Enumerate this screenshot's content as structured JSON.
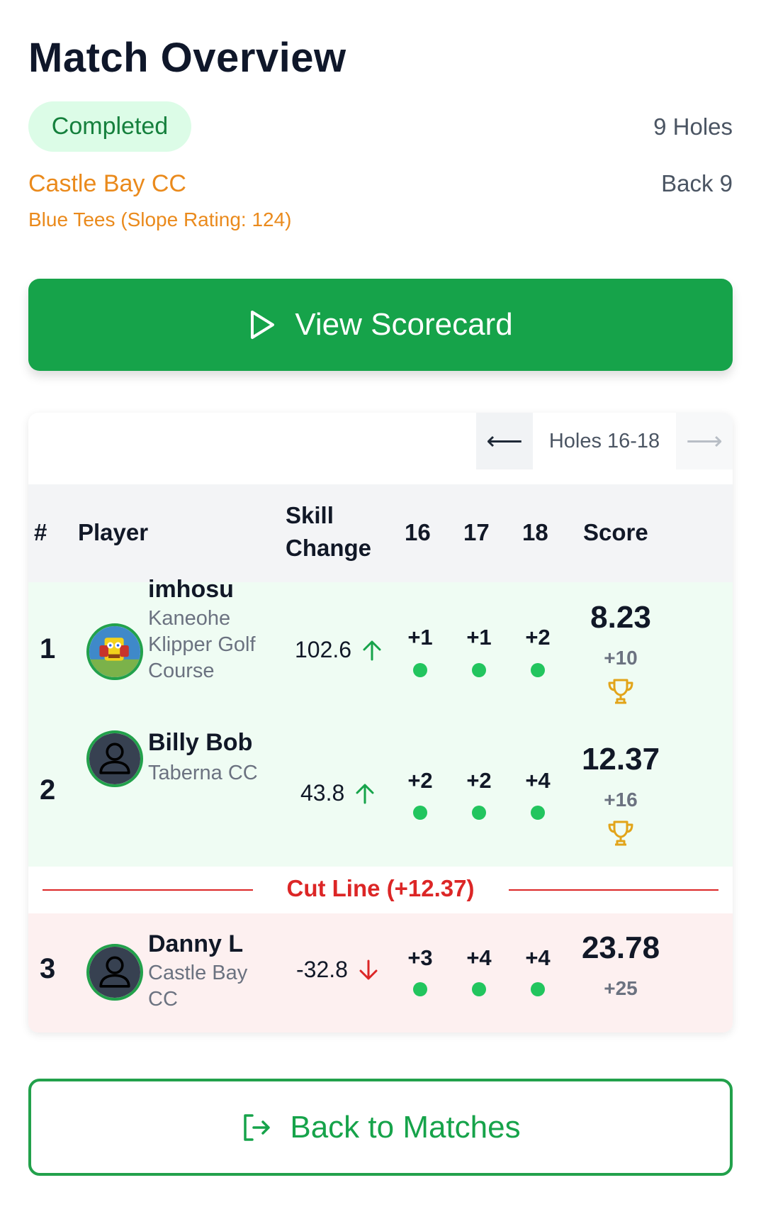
{
  "header": {
    "title": "Match Overview",
    "status": "Completed",
    "holes": "9 Holes",
    "course": "Castle Bay CC",
    "nine": "Back 9",
    "tees": "Blue Tees (Slope Rating: 124)"
  },
  "actions": {
    "view_scorecard": "View Scorecard",
    "back_to_matches": "Back to Matches"
  },
  "leaderboard": {
    "nav": {
      "prev_icon": "arrow-left-icon",
      "range": "Holes 16-18",
      "next_icon": "arrow-right-icon"
    },
    "columns": {
      "rank": "#",
      "player": "Player",
      "skill_line1": "Skill",
      "skill_line2": "Change",
      "h1": "16",
      "h2": "17",
      "h3": "18",
      "score": "Score"
    },
    "rows": [
      {
        "rank": "1",
        "name": "imhosu",
        "club_lines": [
          "Kaneohe",
          "Klipper Golf",
          "Course"
        ],
        "skill": "102.6",
        "skill_trend": "up",
        "holes": [
          "+1",
          "+1",
          "+2"
        ],
        "score": "8.23",
        "diff": "+10",
        "trophy": true
      },
      {
        "rank": "2",
        "name": "Billy Bob",
        "club_lines": [
          "Taberna CC"
        ],
        "skill": "43.8",
        "skill_trend": "up",
        "holes": [
          "+2",
          "+2",
          "+4"
        ],
        "score": "12.37",
        "diff": "+16",
        "trophy": true
      },
      {
        "rank": "3",
        "name": "Danny L",
        "club_lines": [
          "Castle Bay",
          "CC"
        ],
        "skill": "-32.8",
        "skill_trend": "down",
        "holes": [
          "+3",
          "+4",
          "+4"
        ],
        "score": "23.78",
        "diff": "+25",
        "trophy": false
      }
    ],
    "cut_line": {
      "label": "Cut Line",
      "value": "(+12.37)"
    }
  },
  "colors": {
    "primary_green": "#16a34a",
    "accent_orange": "#ea8a1c",
    "cut_red": "#dc2626",
    "trophy_gold": "#e2a419",
    "win_row_bg": "#effcf3",
    "cut_row_bg": "#fdf0f0"
  }
}
